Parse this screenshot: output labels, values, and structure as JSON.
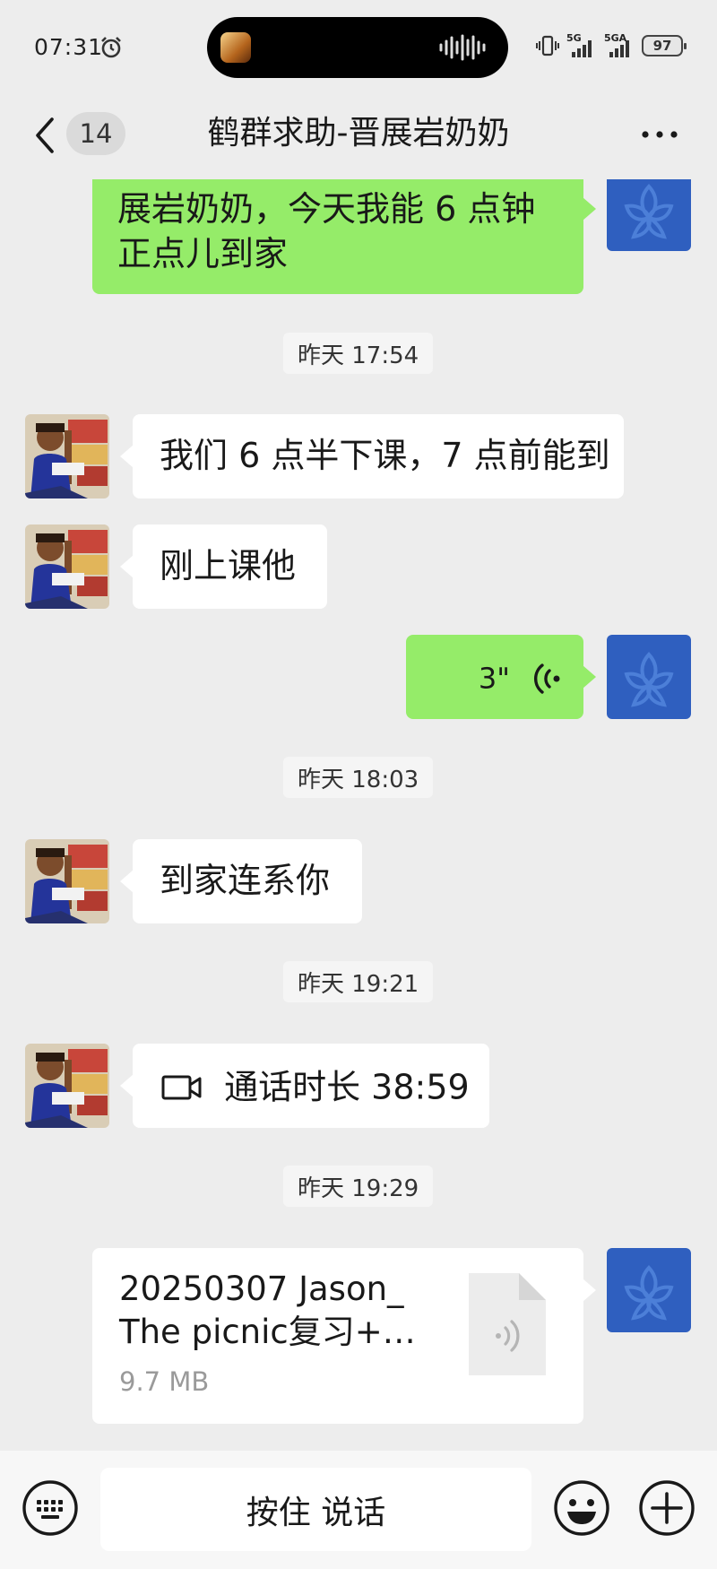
{
  "status_bar": {
    "time": "07:31",
    "net1": "5G",
    "net2": "5GA",
    "battery": "97"
  },
  "header": {
    "unread_count": "14",
    "title": "鹤群求助-晋展岩奶奶"
  },
  "messages": {
    "m1_line1": "展岩奶奶，今天我能 6 点钟",
    "m1_line2": "正点儿到家",
    "ts1": "昨天 17:54",
    "m2": "我们 6 点半下课，7 点前能到",
    "m3": "刚上课他",
    "voice_duration": "3\"",
    "ts2": "昨天 18:03",
    "m4": "到家连系你",
    "ts3": "昨天 19:21",
    "call_text": "通话时长 38:59",
    "ts4": "昨天 19:29",
    "file_name_line1": "20250307 Jason_",
    "file_name_line2": "The picnic复习+…",
    "file_size": "9.7 MB"
  },
  "input_bar": {
    "hold_to_talk": "按住 说话"
  },
  "colors": {
    "background": "#ededed",
    "outgoing_bubble": "#95ec69",
    "incoming_bubble": "#ffffff",
    "self_avatar": "#2f5fbf"
  },
  "icons": [
    "alarm-icon",
    "soundwave-icon",
    "vibrate-icon",
    "signal-icon",
    "back-chevron-icon",
    "more-icon",
    "voice-wave-icon",
    "video-call-icon",
    "audio-file-icon",
    "keyboard-icon",
    "emoji-icon",
    "plus-icon"
  ]
}
